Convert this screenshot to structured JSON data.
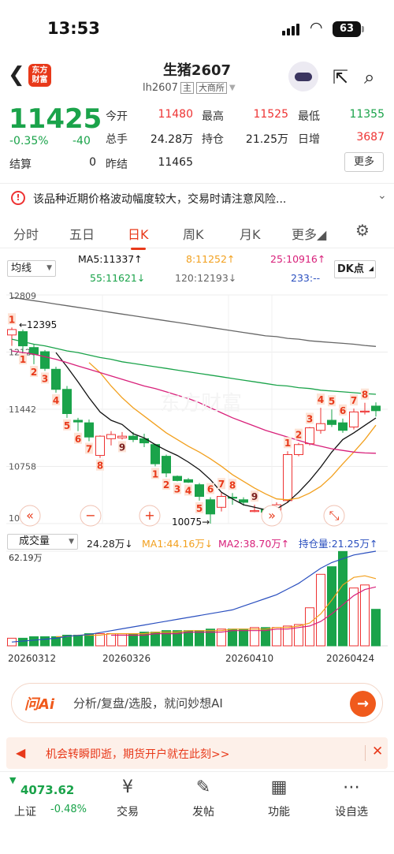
{
  "status": {
    "time": "13:53",
    "battery": "63"
  },
  "header": {
    "back_icon": "chevron-left-icon",
    "logo_text": "东方财富",
    "title": "生猪2607",
    "code": "lh2607",
    "tag_main": "主",
    "tag_exchange": "大商所"
  },
  "quote": {
    "price": "11425",
    "change_pct": "-0.35%",
    "change": "-40",
    "fields": [
      {
        "label": "今开",
        "value": "11480",
        "color": "#e33"
      },
      {
        "label": "最高",
        "value": "11525",
        "color": "#e33"
      },
      {
        "label": "最低",
        "value": "11355",
        "color": "#1aa34a"
      },
      {
        "label": "总手",
        "value": "24.28万",
        "color": "#222"
      },
      {
        "label": "持仓",
        "value": "21.25万",
        "color": "#222"
      },
      {
        "label": "日增",
        "value": "3687",
        "color": "#e33"
      },
      {
        "label": "结算",
        "value": "0",
        "color": "#222"
      },
      {
        "label": "昨结",
        "value": "11465",
        "color": "#222"
      }
    ],
    "more_label": "更多"
  },
  "warning": {
    "text": "该品种近期价格波动幅度较大，交易时请注意风险..."
  },
  "tabs": {
    "items": [
      "分时",
      "五日",
      "日K",
      "周K",
      "月K",
      "更多"
    ],
    "active": "日K"
  },
  "ma_bar": {
    "select": "均线",
    "ma5": "MA5:11337↑",
    "ma8": "8:11252↑",
    "ma25": "25:10916↑",
    "ma55": "55:11621↓",
    "ma120": "120:12193↓",
    "ma233": "233:--",
    "dk": "DK点"
  },
  "price_axis": {
    "labels": [
      "12809",
      "12126",
      "11442",
      "10758",
      "10075"
    ]
  },
  "annotations": {
    "high": "12395",
    "low": "10075"
  },
  "volume_bar": {
    "select": "成交量",
    "vol": "24.28万↓",
    "ma1": "MA1:44.16万↓",
    "ma2": "MA2:38.70万↑",
    "oi": "持仓量:21.25万↑",
    "max": "62.19万"
  },
  "dates": [
    "20260312",
    "20260326",
    "20260410",
    "20260424"
  ],
  "chart_data": {
    "type": "candlestick",
    "y_range": [
      10075,
      12809
    ],
    "candles": [
      {
        "o": 12330,
        "c": 12395,
        "h": 12420,
        "l": 12200
      },
      {
        "o": 12370,
        "c": 12200,
        "h": 12395,
        "l": 12130
      },
      {
        "o": 12180,
        "c": 12100,
        "h": 12220,
        "l": 11980
      },
      {
        "o": 12130,
        "c": 11930,
        "h": 12150,
        "l": 11900
      },
      {
        "o": 11920,
        "c": 11680,
        "h": 11950,
        "l": 11640
      },
      {
        "o": 11680,
        "c": 11390,
        "h": 11720,
        "l": 11340
      },
      {
        "o": 11310,
        "c": 11290,
        "h": 11340,
        "l": 11180
      },
      {
        "o": 11280,
        "c": 11110,
        "h": 11320,
        "l": 11060
      },
      {
        "o": 10890,
        "c": 11120,
        "h": 11130,
        "l": 10860
      },
      {
        "o": 11090,
        "c": 11140,
        "h": 11180,
        "l": 11010
      },
      {
        "o": 11100,
        "c": 11120,
        "h": 11170,
        "l": 11080
      },
      {
        "o": 11120,
        "c": 11080,
        "h": 11170,
        "l": 11050
      },
      {
        "o": 11090,
        "c": 11040,
        "h": 11150,
        "l": 10990
      },
      {
        "o": 11020,
        "c": 10790,
        "h": 11030,
        "l": 10760
      },
      {
        "o": 10880,
        "c": 10680,
        "h": 10900,
        "l": 10630
      },
      {
        "o": 10640,
        "c": 10590,
        "h": 10650,
        "l": 10580
      },
      {
        "o": 10600,
        "c": 10570,
        "h": 10620,
        "l": 10560
      },
      {
        "o": 10540,
        "c": 10400,
        "h": 10560,
        "l": 10350
      },
      {
        "o": 10360,
        "c": 10190,
        "h": 10390,
        "l": 10075
      },
      {
        "o": 10270,
        "c": 10400,
        "h": 10450,
        "l": 10220
      },
      {
        "o": 10390,
        "c": 10380,
        "h": 10440,
        "l": 10300
      },
      {
        "o": 10360,
        "c": 10330,
        "h": 10390,
        "l": 10290
      },
      {
        "o": 10220,
        "c": 10230,
        "h": 10300,
        "l": 10210
      },
      {
        "o": 10250,
        "c": 10210,
        "h": 10270,
        "l": 10150
      },
      {
        "o": 10170,
        "c": 10300,
        "h": 10330,
        "l": 10120
      },
      {
        "o": 10350,
        "c": 10900,
        "h": 10940,
        "l": 10320
      },
      {
        "o": 10900,
        "c": 11020,
        "h": 11040,
        "l": 10880
      },
      {
        "o": 11030,
        "c": 11220,
        "h": 11230,
        "l": 11010
      },
      {
        "o": 11190,
        "c": 11270,
        "h": 11460,
        "l": 11150
      },
      {
        "o": 11310,
        "c": 11260,
        "h": 11440,
        "l": 11230
      },
      {
        "o": 11280,
        "c": 11190,
        "h": 11330,
        "l": 11160
      },
      {
        "o": 11230,
        "c": 11410,
        "h": 11450,
        "l": 11200
      },
      {
        "o": 11410,
        "c": 11420,
        "h": 11520,
        "l": 11380
      },
      {
        "o": 11480,
        "c": 11425,
        "h": 11525,
        "l": 11355
      }
    ],
    "marks": [
      {
        "i": 0,
        "t": "1",
        "c": "#e8391a",
        "pos": "up"
      },
      {
        "i": 1,
        "t": "1",
        "c": "#e8391a",
        "pos": "dn"
      },
      {
        "i": 2,
        "t": "2",
        "c": "#e8391a",
        "pos": "dn"
      },
      {
        "i": 3,
        "t": "3",
        "c": "#e8391a",
        "pos": "dn"
      },
      {
        "i": 4,
        "t": "4",
        "c": "#e8391a",
        "pos": "dn"
      },
      {
        "i": 5,
        "t": "5",
        "c": "#e8391a",
        "pos": "dn"
      },
      {
        "i": 6,
        "t": "6",
        "c": "#e8391a",
        "pos": "dn"
      },
      {
        "i": 7,
        "t": "7",
        "c": "#e8391a",
        "pos": "dn"
      },
      {
        "i": 8,
        "t": "8",
        "c": "#e8391a",
        "pos": "dn"
      },
      {
        "i": 10,
        "t": "9",
        "c": "#7a1f1f",
        "pos": "dn"
      },
      {
        "i": 13,
        "t": "1",
        "c": "#e8391a",
        "pos": "dn"
      },
      {
        "i": 14,
        "t": "2",
        "c": "#e8391a",
        "pos": "dn"
      },
      {
        "i": 15,
        "t": "3",
        "c": "#e8391a",
        "pos": "dn"
      },
      {
        "i": 16,
        "t": "4",
        "c": "#e8391a",
        "pos": "dn"
      },
      {
        "i": 17,
        "t": "5",
        "c": "#e8391a",
        "pos": "dn"
      },
      {
        "i": 18,
        "t": "6",
        "c": "#e8391a",
        "pos": "up"
      },
      {
        "i": 19,
        "t": "7",
        "c": "#e8391a",
        "pos": "up"
      },
      {
        "i": 20,
        "t": "8",
        "c": "#e8391a",
        "pos": "up"
      },
      {
        "i": 22,
        "t": "9",
        "c": "#7a1f1f",
        "pos": "up"
      },
      {
        "i": 25,
        "t": "1",
        "c": "#e8391a",
        "pos": "up"
      },
      {
        "i": 26,
        "t": "2",
        "c": "#e8391a",
        "pos": "up"
      },
      {
        "i": 27,
        "t": "3",
        "c": "#e8391a",
        "pos": "up"
      },
      {
        "i": 28,
        "t": "4",
        "c": "#e8391a",
        "pos": "up"
      },
      {
        "i": 29,
        "t": "5",
        "c": "#e8391a",
        "pos": "up"
      },
      {
        "i": 30,
        "t": "6",
        "c": "#e8391a",
        "pos": "up"
      },
      {
        "i": 31,
        "t": "7",
        "c": "#e8391a",
        "pos": "up"
      },
      {
        "i": 32,
        "t": "8",
        "c": "#e8391a",
        "pos": "up"
      }
    ],
    "ma_lines": [
      {
        "name": "MA5",
        "color": "#111",
        "values": [
          null,
          null,
          null,
          null,
          12120,
          11950,
          11770,
          11580,
          11410,
          11310,
          11260,
          11150,
          11100,
          11020,
          10950,
          10890,
          10810,
          10720,
          10600,
          10450,
          10370,
          10300,
          10270,
          10240,
          10250,
          10330,
          10450,
          10590,
          10750,
          10930,
          11080,
          11160,
          11250,
          11337
        ]
      },
      {
        "name": "MA8",
        "color": "#f2a01e",
        "values": [
          null,
          null,
          null,
          null,
          null,
          null,
          null,
          12000,
          11880,
          11720,
          11580,
          11460,
          11360,
          11260,
          11160,
          11080,
          11000,
          10930,
          10850,
          10760,
          10660,
          10580,
          10500,
          10430,
          10370,
          10360,
          10380,
          10440,
          10520,
          10640,
          10790,
          10930,
          11080,
          11252
        ]
      },
      {
        "name": "MA25",
        "color": "#d8207a",
        "values": [
          12140,
          12120,
          12100,
          12070,
          12040,
          12000,
          11960,
          11920,
          11880,
          11840,
          11800,
          11760,
          11720,
          11690,
          11650,
          11610,
          11570,
          11520,
          11460,
          11400,
          11340,
          11290,
          11240,
          11190,
          11150,
          11110,
          11070,
          11030,
          11000,
          10970,
          10950,
          10930,
          10920,
          10916
        ]
      },
      {
        "name": "MA55",
        "color": "#1aa34a",
        "values": [
          12280,
          12250,
          12220,
          12200,
          12170,
          12140,
          12120,
          12090,
          12060,
          12040,
          12010,
          11990,
          11970,
          11950,
          11930,
          11910,
          11890,
          11870,
          11850,
          11830,
          11810,
          11790,
          11770,
          11750,
          11730,
          11720,
          11700,
          11690,
          11670,
          11660,
          11650,
          11640,
          11630,
          11621
        ]
      },
      {
        "name": "MA120",
        "color": "#666",
        "values": [
          12780,
          12760,
          12740,
          12720,
          12700,
          12680,
          12660,
          12640,
          12620,
          12600,
          12580,
          12560,
          12540,
          12520,
          12500,
          12480,
          12460,
          12440,
          12420,
          12400,
          12380,
          12360,
          12340,
          12320,
          12310,
          12290,
          12280,
          12260,
          12250,
          12240,
          12230,
          12220,
          12205,
          12193
        ]
      }
    ],
    "volume": {
      "max": 62.19,
      "bars": [
        5,
        5,
        6,
        6,
        6,
        7,
        7,
        8,
        8,
        8,
        8,
        8,
        9,
        9,
        10,
        10,
        10,
        10,
        11,
        11,
        11,
        11,
        12,
        12,
        12,
        13,
        14,
        25,
        47,
        52,
        62,
        38,
        40,
        24
      ],
      "ma1": [
        null,
        null,
        null,
        null,
        6,
        6,
        7,
        7,
        7,
        8,
        8,
        8,
        8,
        9,
        9,
        9,
        10,
        10,
        10,
        10,
        11,
        11,
        11,
        11,
        12,
        12,
        13,
        15,
        21,
        30,
        40,
        45,
        46,
        44.16
      ],
      "ma2": [
        null,
        null,
        null,
        null,
        null,
        null,
        null,
        null,
        null,
        7,
        7,
        7,
        7,
        8,
        8,
        8,
        9,
        9,
        9,
        9,
        10,
        10,
        10,
        10,
        11,
        11,
        12,
        13,
        16,
        21,
        27,
        33,
        37,
        38.7
      ],
      "oi": [
        2,
        2.5,
        3,
        3.5,
        4,
        5,
        5.5,
        6,
        7,
        8,
        9,
        10,
        11,
        12,
        13,
        14,
        15,
        16,
        17,
        18,
        19,
        21,
        23,
        25,
        27,
        30,
        33,
        37,
        41,
        44,
        46,
        48,
        49,
        50
      ]
    }
  },
  "chart_tools": {
    "left": "《",
    "minus": "−",
    "plus": "+",
    "right": "》",
    "expand": "expand-icon"
  },
  "ai": {
    "logo": "问Ai",
    "placeholder": "分析/复盘/选股，就问妙想AI"
  },
  "promo": {
    "text": "机会转瞬即逝，期货开户就在此刻>>"
  },
  "bottom_nav": {
    "index_value": "4073.62",
    "index_name": "上证",
    "index_change": "-0.48%",
    "items": [
      {
        "label": "交易",
        "icon": "yen-icon"
      },
      {
        "label": "发帖",
        "icon": "edit-icon"
      },
      {
        "label": "功能",
        "icon": "grid-icon"
      },
      {
        "label": "设自选",
        "icon": "more-icon"
      }
    ]
  }
}
